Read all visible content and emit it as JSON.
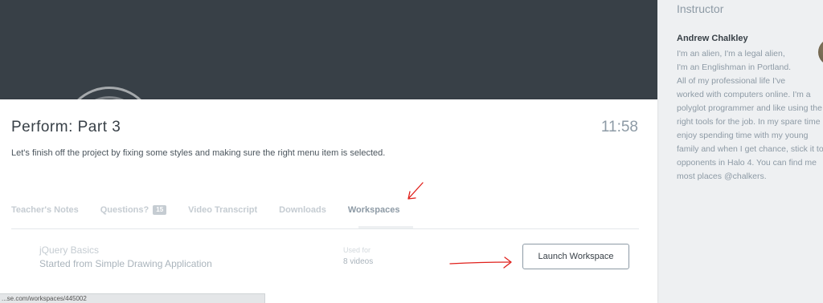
{
  "lesson": {
    "title": "Perform: Part 3",
    "duration": "11:58",
    "description": "Let's finish off the project by fixing some styles and making sure the right menu item is selected."
  },
  "tabs": [
    {
      "label": "Teacher's Notes",
      "active": false
    },
    {
      "label": "Questions?",
      "badge": "15",
      "active": false
    },
    {
      "label": "Video Transcript",
      "active": false
    },
    {
      "label": "Downloads",
      "active": false
    },
    {
      "label": "Workspaces",
      "active": true
    }
  ],
  "workspace": {
    "name": "jQuery Basics",
    "subtitle": "Started from Simple Drawing Application",
    "used_for_label": "Used for",
    "used_for_value": "8 videos",
    "launch_label": "Launch Workspace"
  },
  "status_bar": {
    "url": "...se.com/workspaces/445002"
  },
  "sidebar": {
    "heading": "Instructor",
    "instructor_name": "Andrew Chalkley",
    "bio_lines": [
      "I'm an alien, I'm a legal alien,",
      "I'm an Englishman in Portland.",
      "All of my professional life I've",
      "worked with computers online. I'm a",
      "polyglot programmer and like using the",
      "right tools for the job. In my spare time I",
      "enjoy spending time with my young",
      "family and when I get chance, stick it to",
      "opponents in Halo 4. You can find me",
      "most places @chalkers."
    ]
  },
  "annotations": {
    "arrow_color": "#e0201b"
  },
  "colors": {
    "video_bg": "#384047",
    "page_bg": "#eef0f2",
    "text_dark": "#384047",
    "text_muted": "#8d9aa5"
  }
}
